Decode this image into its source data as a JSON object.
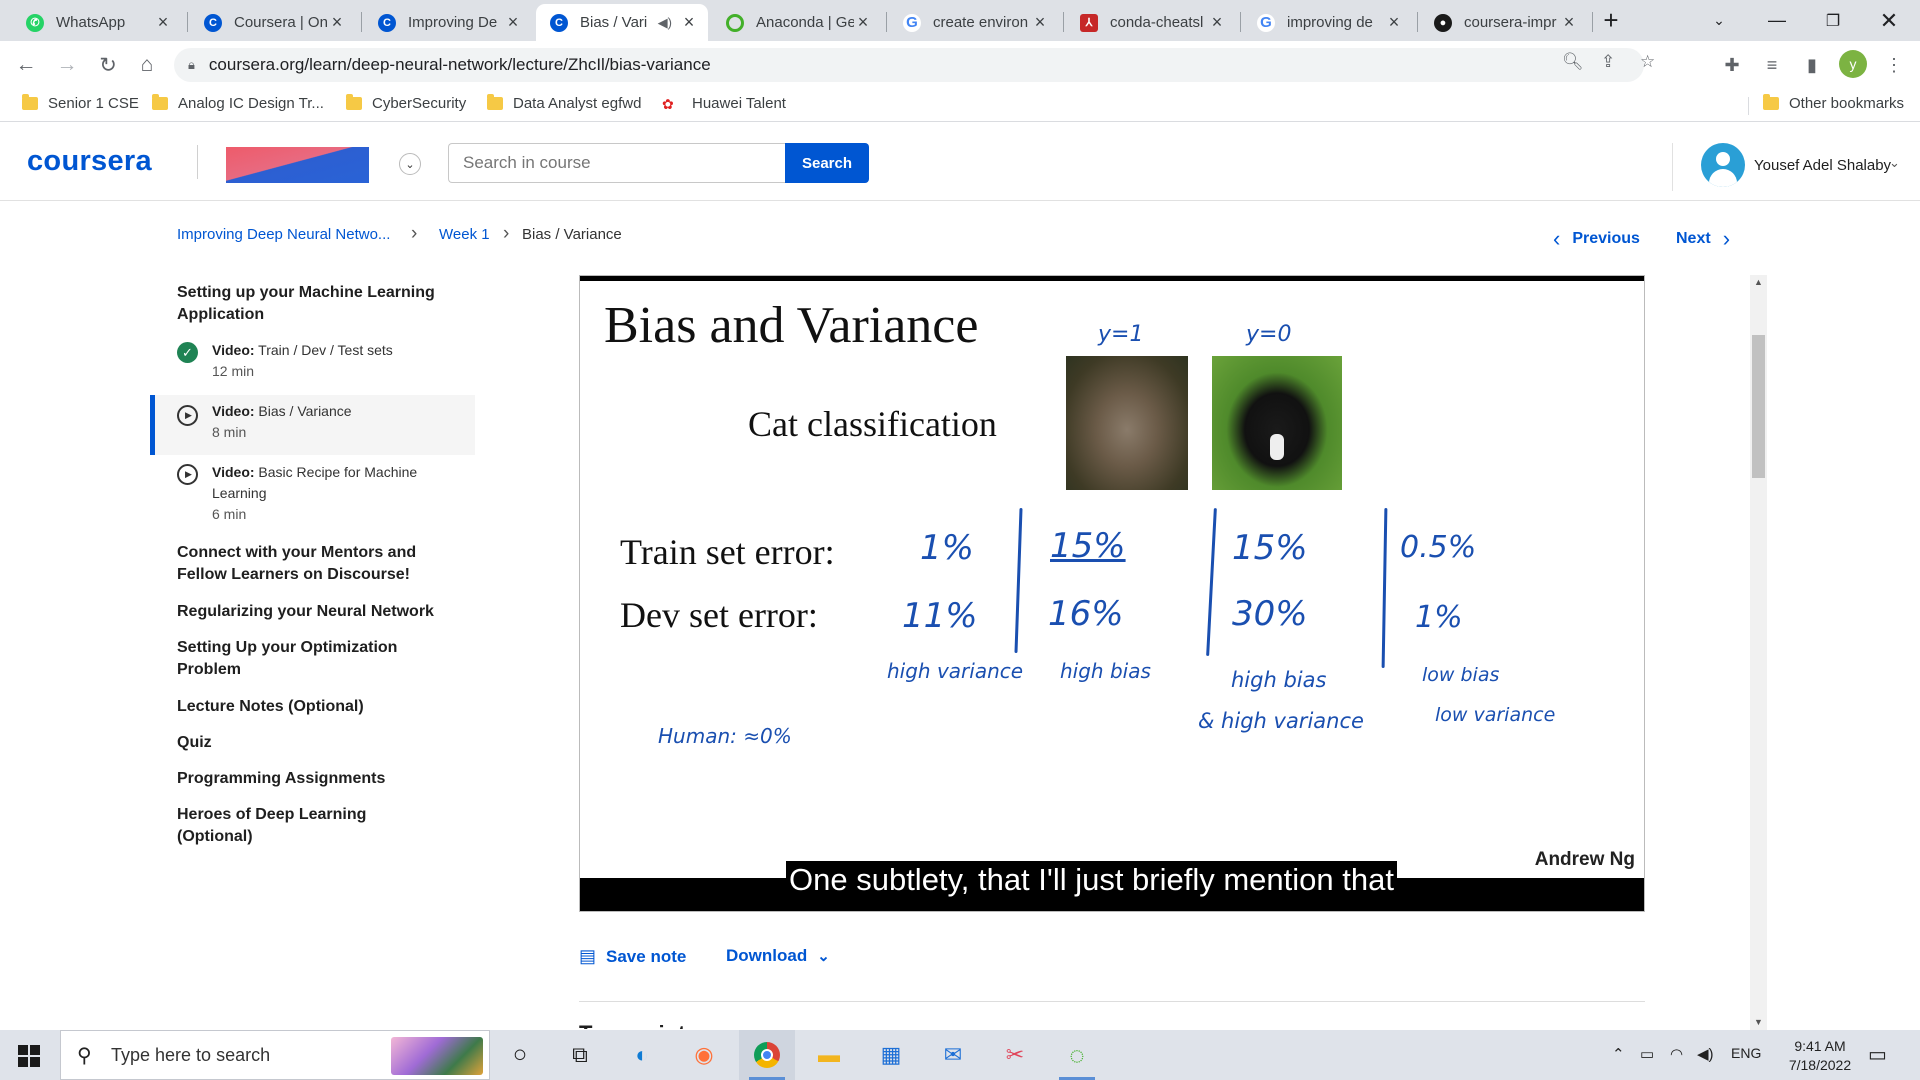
{
  "browser": {
    "tabs": [
      {
        "title": "WhatsApp",
        "icon": "whatsapp-icon"
      },
      {
        "title": "Coursera | Onl",
        "icon": "coursera-icon"
      },
      {
        "title": "Improving De",
        "icon": "coursera-icon"
      },
      {
        "title": "Bias / Vari",
        "icon": "coursera-icon",
        "active": true,
        "audio": true
      },
      {
        "title": "Anaconda | Ge",
        "icon": "anaconda-icon"
      },
      {
        "title": "create environ",
        "icon": "google-icon"
      },
      {
        "title": "conda-cheatsl",
        "icon": "pdf-icon"
      },
      {
        "title": "improving de",
        "icon": "google-icon"
      },
      {
        "title": "coursera-impr",
        "icon": "github-icon"
      }
    ],
    "new_tab": "+",
    "url": "coursera.org/learn/deep-neural-network/lecture/ZhcIl/bias-variance",
    "profile_initial": "y",
    "bookmarks": [
      "Senior 1 CSE",
      "Analog IC Design Tr...",
      "CyberSecurity",
      "Data Analyst egfwd",
      "Huawei Talent"
    ],
    "other_bookmarks": "Other bookmarks"
  },
  "header": {
    "logo": "coursera",
    "search_placeholder": "Search in course",
    "search_button": "Search",
    "user_name": "Yousef Adel Shalaby"
  },
  "breadcrumb": [
    "Improving Deep Neural Netwo...",
    "Week 1",
    "Bias / Variance"
  ],
  "nav": {
    "previous": "Previous",
    "next": "Next"
  },
  "sidebar": {
    "section1": "Setting up your Machine Learning Application",
    "items": [
      {
        "type": "Video:",
        "title": "Train / Dev / Test sets",
        "duration": "12 min",
        "status": "completed"
      },
      {
        "type": "Video:",
        "title": "Bias / Variance",
        "duration": "8 min",
        "status": "current"
      },
      {
        "type": "Video:",
        "title": "Basic Recipe for Machine Learning",
        "duration": "6 min",
        "status": "not-started"
      }
    ],
    "sections": [
      "Connect with your Mentors and Fellow Learners on Discourse!",
      "Regularizing your Neural Network",
      "Setting Up your Optimization Problem",
      "Lecture Notes (Optional)",
      "Quiz",
      "Programming Assignments",
      "Heroes of Deep Learning (Optional)"
    ]
  },
  "video": {
    "slide_title": "Bias and Variance",
    "slide_subtitle": "Cat classification",
    "train_label": "Train set error:",
    "dev_label": "Dev set error:",
    "label_y1": "y=1",
    "label_y0": "y=0",
    "columns": [
      {
        "train": "1%",
        "dev": "11%",
        "note1": "high variance",
        "note2": ""
      },
      {
        "train": "15%",
        "dev": "16%",
        "note1": "high bias",
        "note2": ""
      },
      {
        "train": "15%",
        "dev": "30%",
        "note1": "high bias",
        "note2": "& high variance"
      },
      {
        "train": "0.5%",
        "dev": "1%",
        "note1": "low bias",
        "note2": "low variance"
      }
    ],
    "human_note": "Human: ≈0%",
    "author": "Andrew Ng",
    "caption": "One subtlety, that I'll just briefly mention that"
  },
  "actions": {
    "save_note": "Save note",
    "download": "Download"
  },
  "transcript_heading": "Transcript",
  "taskbar": {
    "search_placeholder": "Type here to search",
    "language": "ENG",
    "time": "9:41 AM",
    "date": "7/18/2022"
  }
}
